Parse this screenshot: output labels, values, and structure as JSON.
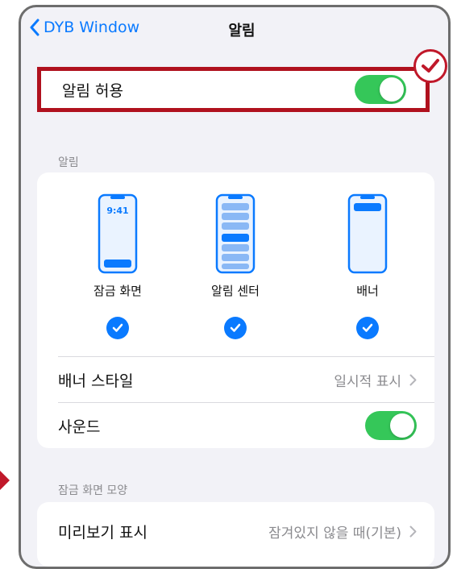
{
  "nav": {
    "back_label": "DYB Window",
    "title": "알림"
  },
  "allow": {
    "label": "알림 허용",
    "enabled": true
  },
  "notifications_section": {
    "header": "알림",
    "styles": [
      {
        "label": "잠금 화면",
        "icon": "lock-screen-phone-icon",
        "time": "9:41",
        "selected": true
      },
      {
        "label": "알림 센터",
        "icon": "notification-center-phone-icon",
        "selected": true
      },
      {
        "label": "배너",
        "icon": "banner-phone-icon",
        "selected": true
      }
    ],
    "banner_style": {
      "label": "배너 스타일",
      "value": "일시적 표시"
    },
    "sound": {
      "label": "사운드",
      "enabled": true
    }
  },
  "lock_screen_section": {
    "header": "잠금 화면 모양",
    "preview": {
      "label": "미리보기 표시",
      "value": "잠겨있지 않을 때(기본)"
    }
  },
  "colors": {
    "accent": "#0a7aff",
    "toggle_on": "#35c759",
    "highlight": "#b0111e",
    "background": "#f2f2f7"
  }
}
